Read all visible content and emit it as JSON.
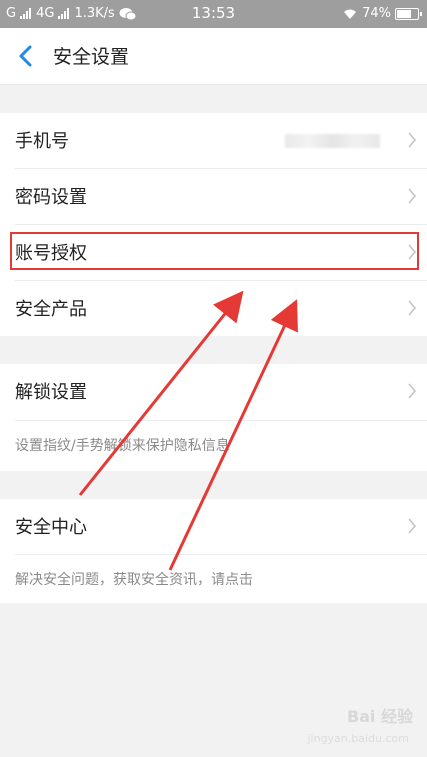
{
  "status_bar": {
    "carrier_left": "G",
    "network": "4G",
    "speed": "1.3K/s",
    "time": "13:53",
    "battery": "74%"
  },
  "header": {
    "title": "安全设置"
  },
  "group1": {
    "items": [
      {
        "label": "手机号"
      },
      {
        "label": "密码设置"
      },
      {
        "label": "账号授权"
      },
      {
        "label": "安全产品"
      }
    ]
  },
  "unlock": {
    "label": "解锁设置",
    "hint": "设置指纹/手势解锁来保护隐私信息"
  },
  "security_center": {
    "label": "安全中心",
    "hint": "解决安全问题，获取安全资讯，请点击"
  },
  "watermark": {
    "brand": "Bai 经验",
    "url": "jingyan.baidu.com"
  },
  "colors": {
    "accent": "#1e88e5",
    "highlight_box": "#e53935"
  }
}
